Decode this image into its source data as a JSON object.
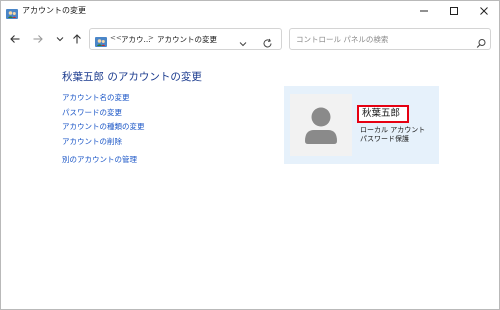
{
  "window": {
    "title": "アカウントの変更",
    "min_glyph": "—",
    "max_glyph": "☐",
    "close_glyph": "✕"
  },
  "nav": {
    "back_icon": "arrow-left-icon",
    "forward_icon": "arrow-right-icon",
    "recent_icon": "chevron-down-icon",
    "up_icon": "arrow-up-icon"
  },
  "address": {
    "overflow": "<<",
    "crumbs": [
      "アカウ...",
      "アカウントの変更"
    ],
    "separator": ">"
  },
  "search": {
    "placeholder": "コントロール パネルの検索"
  },
  "main": {
    "title": "秋葉五郎 のアカウントの変更",
    "links": [
      "アカウント名の変更",
      "パスワードの変更",
      "アカウントの種類の変更",
      "アカウントの削除",
      "別のアカウントの管理"
    ]
  },
  "account": {
    "name": "秋葉五郎",
    "type": "ローカル アカウント",
    "password_status": "パスワード保護",
    "highlight_color": "#e60012",
    "panel_color": "#e6f1fb"
  }
}
